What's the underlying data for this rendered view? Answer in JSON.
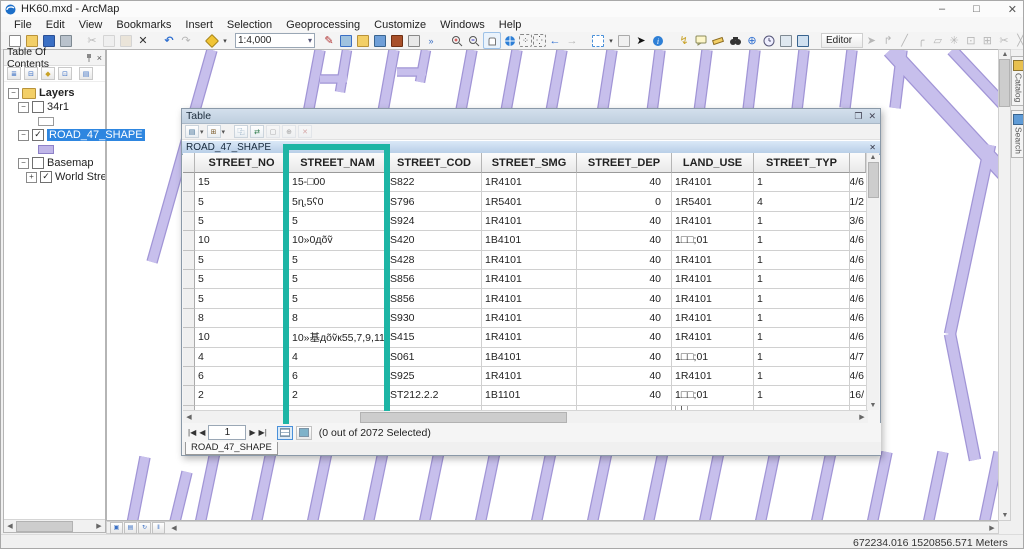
{
  "window": {
    "title": "HK60.mxd - ArcMap",
    "minimize": "–",
    "restore": "□",
    "close": "✕"
  },
  "menu": {
    "items": [
      "File",
      "Edit",
      "View",
      "Bookmarks",
      "Insert",
      "Selection",
      "Geoprocessing",
      "Customize",
      "Windows",
      "Help"
    ]
  },
  "toolbar": {
    "scale_value": "1:4,000",
    "editor_label": "Editor"
  },
  "toc": {
    "title": "Table Of Contents",
    "layers_root": "Layers",
    "layer1": "34r1",
    "layer2": "ROAD_47_SHAPE",
    "layer3": "Basemap",
    "layer4": "World Street Map"
  },
  "table_window": {
    "title": "Table",
    "layer_header": "ROAD_47_SHAPE",
    "columns": [
      "STREET_NO",
      "STREET_NAM",
      "STREET_COD",
      "STREET_SMG",
      "STREET_DEP",
      "LAND_USE",
      "STREET_TYP"
    ],
    "rows": [
      [
        "15",
        "15-□00",
        "S822",
        "1R4101",
        "40",
        "1R4101",
        "1",
        "4/6"
      ],
      [
        "5",
        "5ɳ,5ʕ0",
        "S796",
        "1R5401",
        "0",
        "1R5401",
        "4",
        "1/2"
      ],
      [
        "5",
        "5",
        "S924",
        "1R4101",
        "40",
        "1R4101",
        "1",
        "3/6"
      ],
      [
        "10",
        "10»0дõṽ",
        "S420",
        "1B4101",
        "40",
        "1□□;01",
        "1",
        "4/6"
      ],
      [
        "5",
        "5",
        "S428",
        "1R4101",
        "40",
        "1R4101",
        "1",
        "4/6"
      ],
      [
        "5",
        "5",
        "S856",
        "1R4101",
        "40",
        "1R4101",
        "1",
        "4/6"
      ],
      [
        "5",
        "5",
        "S856",
        "1R4101",
        "40",
        "1R4101",
        "1",
        "4/6"
      ],
      [
        "8",
        "8",
        "S930",
        "1R4101",
        "40",
        "1R4101",
        "1",
        "4/6"
      ],
      [
        "10",
        "10»基дõṽк55,7,9,11",
        "S415",
        "1R4101",
        "40",
        "1R4101",
        "1",
        "4/6"
      ],
      [
        "4",
        "4",
        "S061",
        "1B4101",
        "40",
        "1□□;01",
        "1",
        "4/7"
      ],
      [
        "6",
        "6",
        "S925",
        "1R4101",
        "40",
        "1R4101",
        "1",
        "4/6"
      ],
      [
        "2",
        "2",
        "ST212.2.2",
        "1B1101",
        "40",
        "1□□;01",
        "1",
        "16/"
      ],
      [
        "",
        "",
        "",
        "",
        "",
        "□□",
        "",
        ""
      ]
    ],
    "navigator": {
      "first": "|◀",
      "prev": "◀",
      "record_value": "1",
      "next": "▶",
      "last": "▶|",
      "status": "(0 out of 2072 Selected)"
    },
    "tab_label": "ROAD_47_SHAPE"
  },
  "side_tabs": {
    "catalog": "Catalog",
    "search": "Search"
  },
  "status_bar": {
    "coordinates": "672234.016  1520856.571 Meters"
  },
  "map": {
    "street_fill": "#c7bfec",
    "street_edge": "#a195d6",
    "background": "#ffffff"
  },
  "highlight": {
    "color": "#1db5a5"
  }
}
